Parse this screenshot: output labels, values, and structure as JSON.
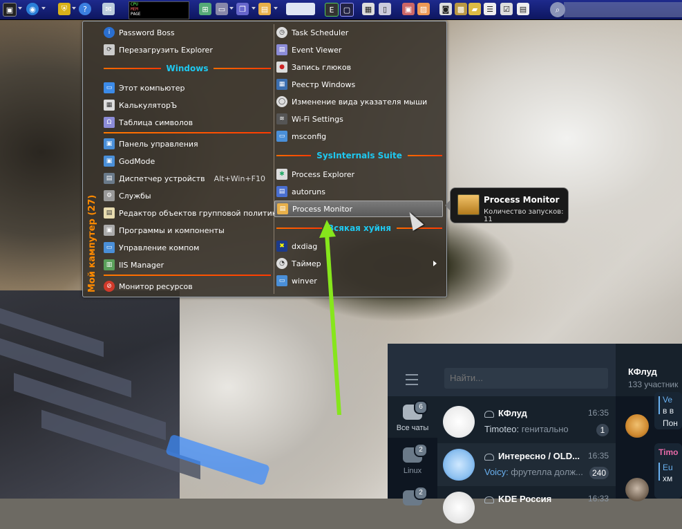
{
  "taskbar": {
    "cpu_meter_labels": [
      "CPU",
      "MEM",
      "PAGE"
    ]
  },
  "start_menu": {
    "side_title": "Мой кампутер (27)",
    "left_items_top": [
      {
        "label": "Password Boss",
        "icon": "info-icon"
      },
      {
        "label": "Перезагрузить Explorer",
        "icon": "explorer-icon"
      }
    ],
    "section_windows": "Windows",
    "left_items_windows": [
      {
        "label": "Этот компьютер",
        "icon": "computer-icon"
      },
      {
        "label": "КалькуляторЪ",
        "icon": "calculator-icon"
      },
      {
        "label": "Таблица символов",
        "icon": "charmap-icon"
      }
    ],
    "left_items_system": [
      {
        "label": "Панель управления",
        "icon": "control-panel-icon",
        "shortcut": ""
      },
      {
        "label": "GodMode",
        "icon": "godmode-icon",
        "shortcut": ""
      },
      {
        "label": "Диспетчер устройств",
        "icon": "device-manager-icon",
        "shortcut": "Alt+Win+F10"
      },
      {
        "label": "Службы",
        "icon": "services-icon",
        "shortcut": ""
      },
      {
        "label": "Редактор объектов групповой политики",
        "icon": "gpedit-icon",
        "shortcut": ""
      },
      {
        "label": "Программы и компоненты",
        "icon": "programs-icon",
        "shortcut": ""
      },
      {
        "label": "Управление компом",
        "icon": "computer-management-icon",
        "shortcut": ""
      },
      {
        "label": "IIS Manager",
        "icon": "iis-icon",
        "shortcut": ""
      }
    ],
    "left_items_bottom": [
      {
        "label": "Монитор ресурсов",
        "icon": "resource-monitor-icon"
      }
    ],
    "right_items_top": [
      {
        "label": "Task Scheduler",
        "icon": "clock-icon"
      },
      {
        "label": "Event Viewer",
        "icon": "event-viewer-icon"
      },
      {
        "label": "Запись глюков",
        "icon": "record-icon"
      },
      {
        "label": "Реестр Windows",
        "icon": "registry-icon"
      },
      {
        "label": "Изменение вида указателя мыши",
        "icon": "mouse-icon"
      },
      {
        "label": "Wi-Fi Settings",
        "icon": "wifi-icon"
      },
      {
        "label": "msconfig",
        "icon": "msconfig-icon"
      }
    ],
    "section_sysinternals": "SysInternals Suite",
    "right_items_sysinternals": [
      {
        "label": "Process Explorer",
        "icon": "process-explorer-icon"
      },
      {
        "label": "autoruns",
        "icon": "autoruns-icon"
      },
      {
        "label": "Process Monitor",
        "icon": "process-monitor-icon"
      }
    ],
    "section_misc": "Всякая хуйня",
    "right_items_misc": [
      {
        "label": "dxdiag",
        "icon": "dxdiag-icon"
      },
      {
        "label": "Таймер",
        "icon": "timer-icon"
      },
      {
        "label": "winver",
        "icon": "winver-icon"
      }
    ]
  },
  "tooltip": {
    "title": "Process Monitor",
    "subtitle": "Количество запусков: 11"
  },
  "telegram": {
    "search_placeholder": "Найти...",
    "chat_title": "КФлуд",
    "chat_members": "133 участник",
    "folders": [
      {
        "label": "Все чаты",
        "badge": "6"
      },
      {
        "label": "Linux",
        "badge": "2"
      },
      {
        "label": "",
        "badge": "2"
      }
    ],
    "chats": [
      {
        "name": "КФлуд",
        "time": "16:35",
        "sender": "Timoteo:",
        "preview": " генитально",
        "unread": "1"
      },
      {
        "name": "Интересно / OLD...",
        "time": "16:35",
        "sender": "Voicy:",
        "preview": " фрутелла долж...",
        "unread": "240"
      },
      {
        "name": "KDE Россия",
        "time": "16:33",
        "sender": "",
        "preview": "",
        "unread": ""
      }
    ],
    "messages": [
      {
        "author": "Ve",
        "text": "в в"
      },
      {
        "author": "",
        "text": "Пон"
      },
      {
        "author": "Timo",
        "text": ""
      },
      {
        "author": "Eu",
        "text": "хм"
      }
    ]
  },
  "colors": {
    "menu_section_text": "#1ec8f0",
    "menu_separator": "#ff5a00",
    "side_title": "#ff8a00",
    "annotation_arrow": "#86e61c"
  }
}
